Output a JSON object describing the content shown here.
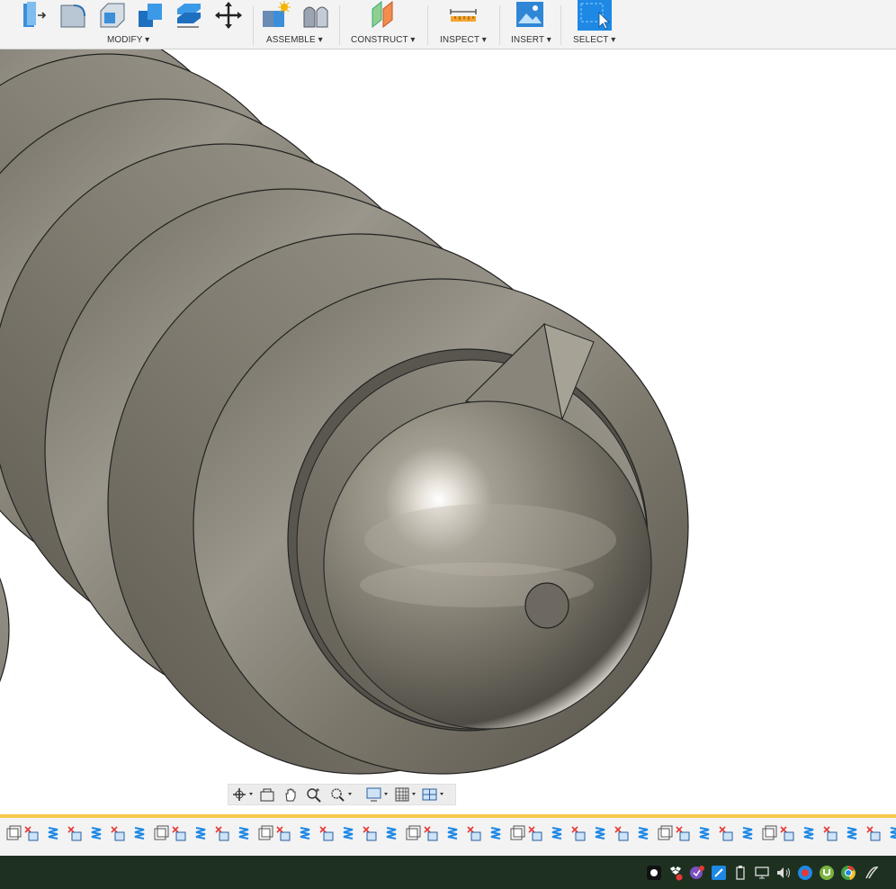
{
  "toolbar": {
    "groups": [
      {
        "label": "MODIFY ▾"
      },
      {
        "label": "ASSEMBLE ▾"
      },
      {
        "label": "CONSTRUCT ▾"
      },
      {
        "label": "INSPECT ▾"
      },
      {
        "label": "INSERT ▾"
      },
      {
        "label": "SELECT ▾"
      }
    ],
    "modify_icons": [
      "press-pull-icon",
      "fillet-icon",
      "shell-icon",
      "combine-icon",
      "split-body-icon",
      "move-icon"
    ],
    "assemble_icons": [
      "new-component-icon",
      "joint-icon"
    ],
    "construct_icons": [
      "offset-plane-icon"
    ],
    "inspect_icons": [
      "measure-icon"
    ],
    "insert_icons": [
      "insert-image-icon"
    ],
    "select_icons": [
      "select-icon"
    ]
  },
  "navbar": {
    "icons": [
      "orbit-icon",
      "look-at-icon",
      "pan-icon",
      "zoom-icon",
      "zoom-window-icon",
      "display-settings-icon",
      "grid-settings-icon",
      "viewport-layout-icon"
    ]
  },
  "timeline": {
    "marker_color": "#f6c84b",
    "feature_icons": "repeated sketch / extrude / thread features"
  },
  "taskbar": {
    "tray_icons": [
      "app-icon",
      "dropbox-icon",
      "shield-icon",
      "onedrive-icon",
      "usb-icon",
      "network-icon",
      "volume-icon",
      "record-icon",
      "torrent-icon",
      "chrome-icon",
      "pen-icon"
    ]
  },
  "colors": {
    "toolbar_bg": "#f3f3f3",
    "viewport_bg": "#ffffff",
    "body_metal": "#8a8577",
    "taskbar_bg": "#1e3121",
    "accent_blue": "#1e88e5"
  }
}
